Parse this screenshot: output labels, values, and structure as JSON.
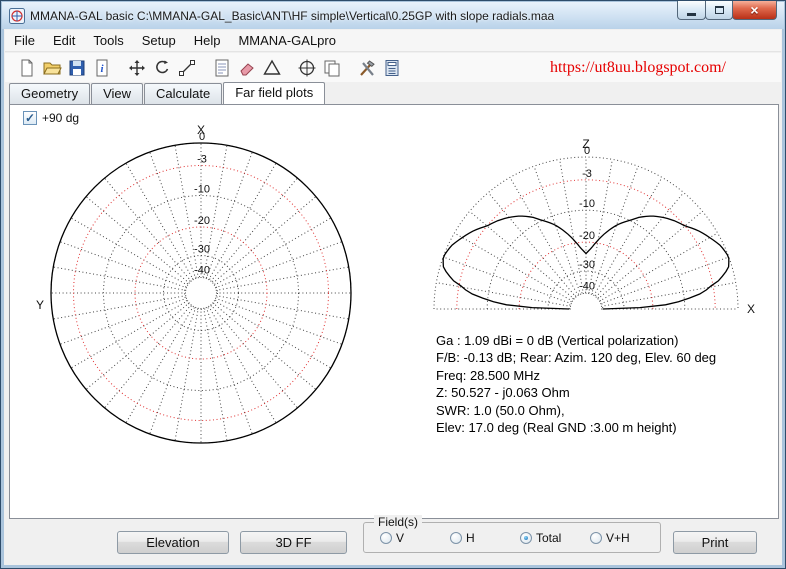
{
  "window": {
    "title": "MMANA-GAL basic C:\\MMANA-GAL_Basic\\ANT\\HF simple\\Vertical\\0.25GP with slope radials.maa",
    "controls": {
      "close_glyph": "×"
    }
  },
  "menu": {
    "items": [
      "File",
      "Edit",
      "Tools",
      "Setup",
      "Help",
      "MMANA-GALpro"
    ]
  },
  "toolbar": {
    "icons": [
      "new-file-icon",
      "open-file-icon",
      "save-icon",
      "file-info-icon",
      "move-icon",
      "rotate-icon",
      "wire-edit-icon",
      "description-icon",
      "eraser-icon",
      "triangle-icon",
      "center-target-icon",
      "copy-icon",
      "tools-icon",
      "calculator-icon"
    ],
    "link": "https://ut8uu.blogspot.com/"
  },
  "tabs": {
    "items": [
      {
        "label": "Geometry",
        "active": false
      },
      {
        "label": "View",
        "active": false
      },
      {
        "label": "Calculate",
        "active": false
      },
      {
        "label": "Far field plots",
        "active": true
      }
    ]
  },
  "plot": {
    "checkbox": {
      "label": "+90 dg",
      "checked": true,
      "glyph": "✓"
    }
  },
  "stats": {
    "lines": [
      "Ga : 1.09 dBi = 0 dB  (Vertical polarization)",
      "F/B: -0.13 dB; Rear: Azim. 120 deg,  Elev. 60 deg",
      "Freq: 28.500 MHz",
      "Z: 50.527 - j0.063 Ohm",
      "SWR: 1.0 (50.0 Ohm),",
      "Elev: 17.0 deg (Real GND  :3.00 m height)"
    ]
  },
  "bottom": {
    "elevation_label": "Elevation",
    "ff3d_label": "3D FF",
    "fields": {
      "title": "Field(s)",
      "options": [
        {
          "label": "V",
          "selected": false
        },
        {
          "label": "H",
          "selected": false
        },
        {
          "label": "Total",
          "selected": true
        },
        {
          "label": "V+H",
          "selected": false
        }
      ]
    },
    "print_label": "Print"
  },
  "chart_meta": {
    "db_radius_map": [
      [
        0,
        1.0
      ],
      [
        -3,
        0.85
      ],
      [
        -10,
        0.65
      ],
      [
        -20,
        0.44
      ],
      [
        -30,
        0.25
      ],
      [
        -40,
        0.11
      ]
    ],
    "grid_color": "#444",
    "red_ring_color": "#e03030"
  },
  "chart_data": [
    {
      "type": "polar-azimuth",
      "title": "Azimuth far field plot (+90 dg)",
      "axis_top": "X",
      "axis_left": "Y",
      "rings_db": [
        0,
        -3,
        -10,
        -20,
        -30,
        -40
      ],
      "red_rings_db": [
        -3,
        -20
      ],
      "radial_step_deg": 10,
      "pattern": {
        "kind": "omnidirectional",
        "level_db": 0
      }
    },
    {
      "type": "polar-elevation-half",
      "title": "Elevation far field plot",
      "axis_top": "Z",
      "axis_right": "X",
      "rings_db": [
        0,
        -3,
        -10,
        -20,
        -30,
        -40
      ],
      "red_rings_db": [
        -3,
        -20
      ],
      "radial_step_deg": 10,
      "pattern": {
        "kind": "elevation",
        "points_elev_deg_db": [
          [
            0,
            -40
          ],
          [
            1,
            -28
          ],
          [
            2,
            -21
          ],
          [
            3,
            -16
          ],
          [
            5,
            -10.5
          ],
          [
            8,
            -5.5
          ],
          [
            12,
            -2.2
          ],
          [
            16,
            -0.5
          ],
          [
            20,
            0
          ],
          [
            25,
            -0.4
          ],
          [
            30,
            -1.2
          ],
          [
            35,
            -2.0
          ],
          [
            40,
            -3.0
          ],
          [
            45,
            -4.0
          ],
          [
            50,
            -5.2
          ],
          [
            55,
            -6.6
          ],
          [
            60,
            -8.4
          ],
          [
            65,
            -10.6
          ],
          [
            70,
            -13
          ],
          [
            75,
            -16
          ],
          [
            80,
            -19
          ],
          [
            85,
            -22
          ],
          [
            90,
            -24
          ]
        ]
      }
    }
  ]
}
